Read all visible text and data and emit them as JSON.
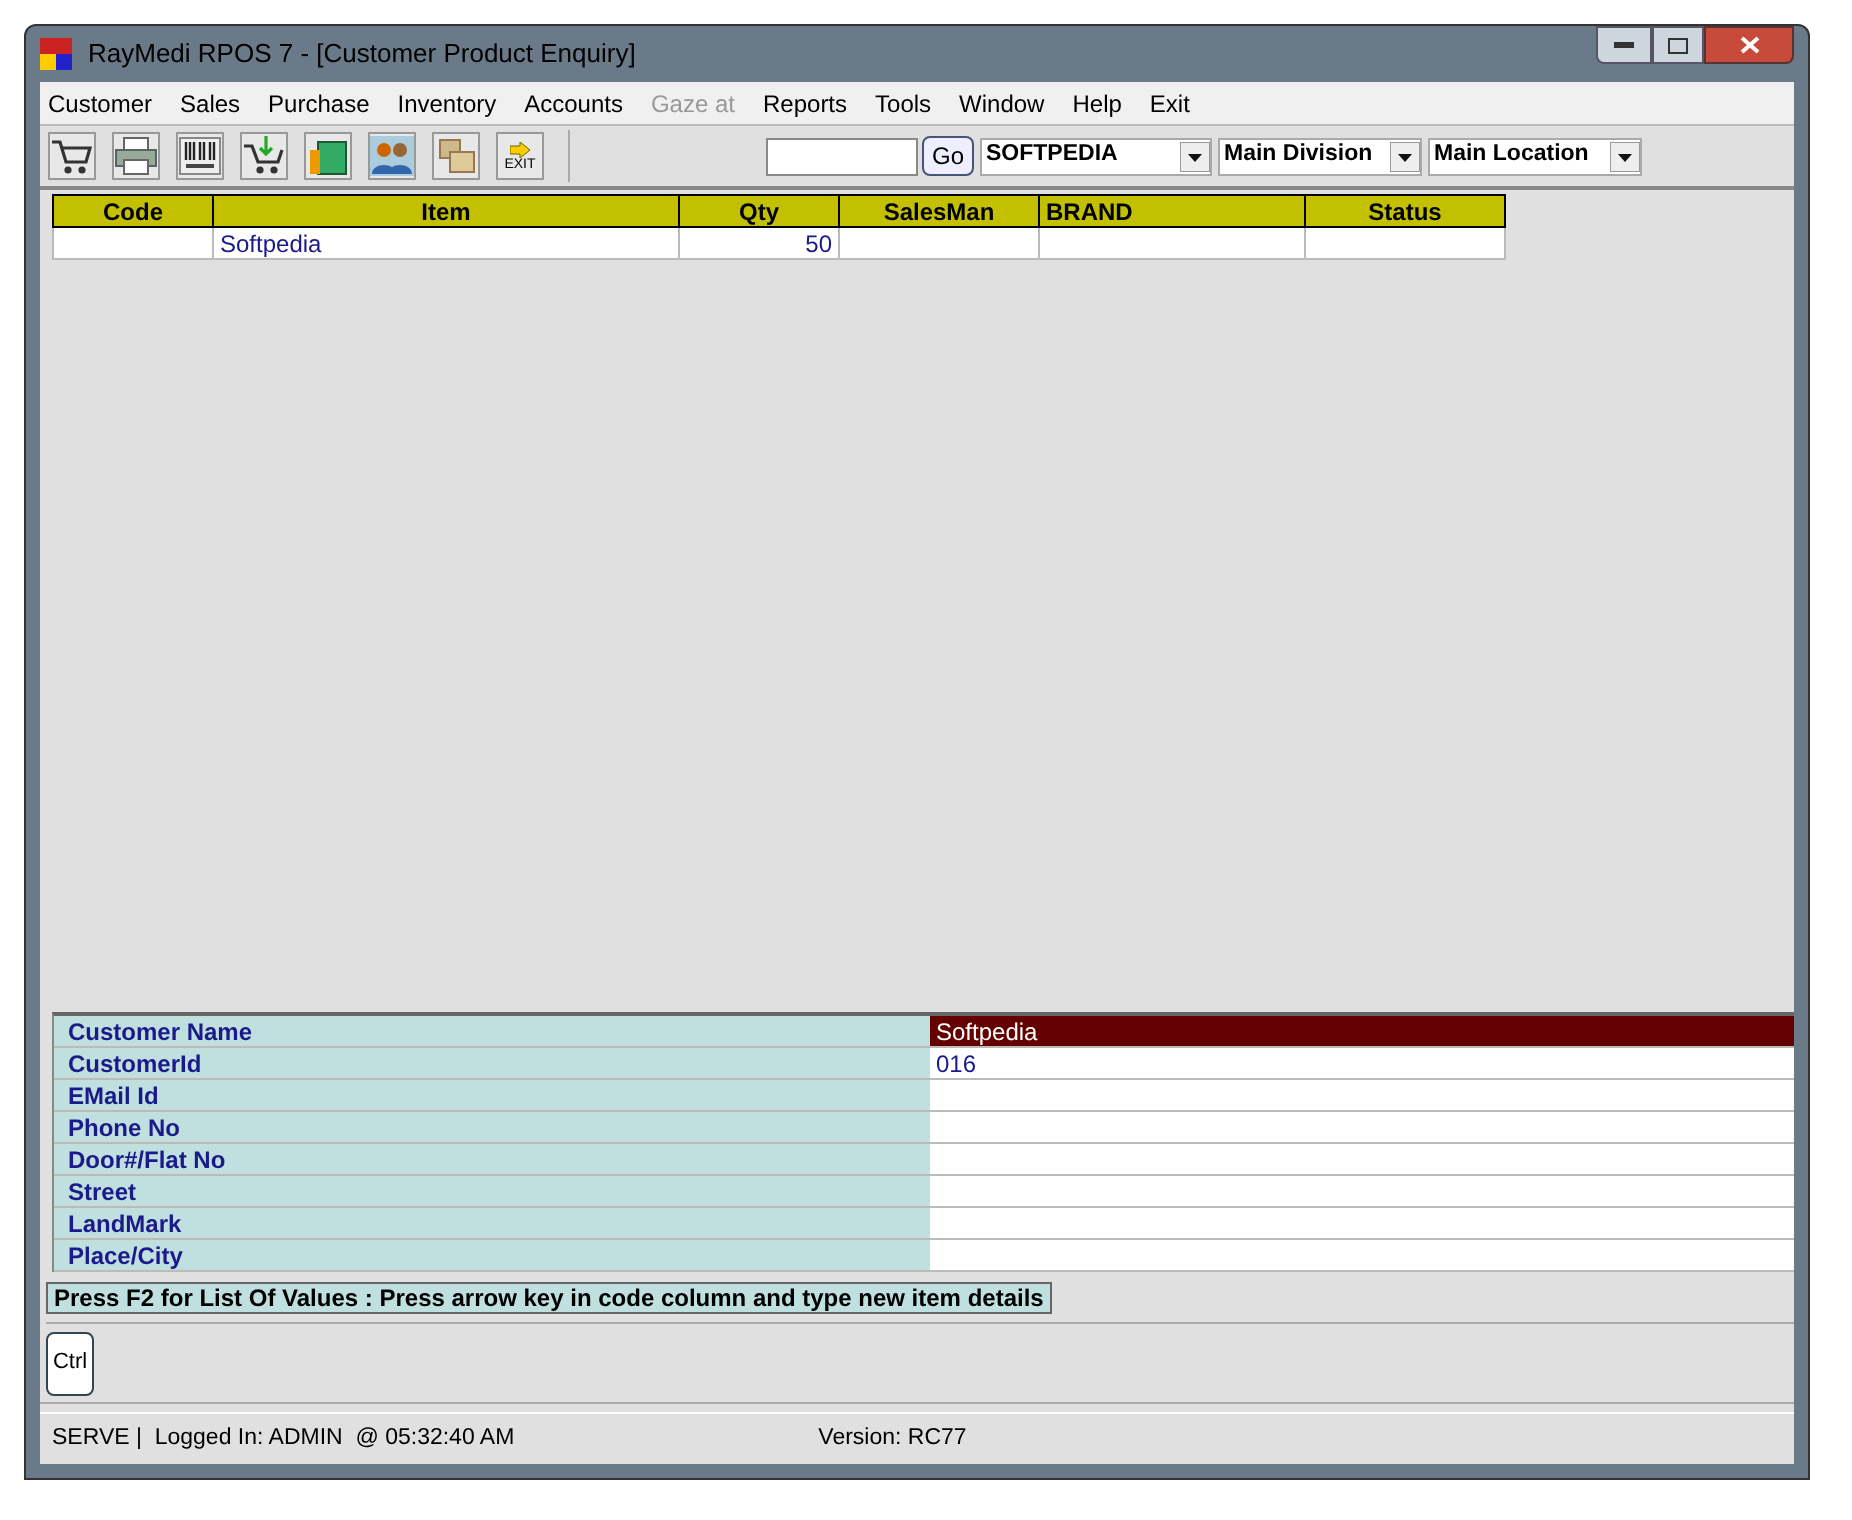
{
  "window": {
    "title": "RayMedi RPOS 7 - [Customer Product Enquiry]"
  },
  "menu": [
    {
      "label": "Customer",
      "disabled": false
    },
    {
      "label": "Sales",
      "disabled": false
    },
    {
      "label": "Purchase",
      "disabled": false
    },
    {
      "label": "Inventory",
      "disabled": false
    },
    {
      "label": "Accounts",
      "disabled": false
    },
    {
      "label": "Gaze at",
      "disabled": true
    },
    {
      "label": "Reports",
      "disabled": false
    },
    {
      "label": "Tools",
      "disabled": false
    },
    {
      "label": "Window",
      "disabled": false
    },
    {
      "label": "Help",
      "disabled": false
    },
    {
      "label": "Exit",
      "disabled": false
    }
  ],
  "toolbar": {
    "exit_label": "EXIT",
    "go_label": "Go",
    "dropdowns": [
      {
        "value": "SOFTPEDIA"
      },
      {
        "value": "Main Division"
      },
      {
        "value": "Main Location"
      }
    ]
  },
  "grid": {
    "columns": [
      {
        "label": "Code"
      },
      {
        "label": "Item"
      },
      {
        "label": "Qty"
      },
      {
        "label": "SalesMan"
      },
      {
        "label": "BRAND"
      },
      {
        "label": "Status"
      }
    ],
    "rows": [
      {
        "cells": [
          "",
          "Softpedia",
          "50",
          "",
          "",
          ""
        ]
      }
    ]
  },
  "customer": [
    {
      "label": "Customer Name",
      "value": "Softpedia",
      "selected": true
    },
    {
      "label": "CustomerId",
      "value": "016",
      "selected": false
    },
    {
      "label": "EMail Id",
      "selected": false
    },
    {
      "label": "Phone No",
      "selected": false
    },
    {
      "label": "Door#/Flat No",
      "selected": false
    },
    {
      "label": "Street",
      "selected": false
    },
    {
      "label": "LandMark",
      "selected": false
    },
    {
      "label": "Place/City",
      "selected": false
    }
  ],
  "hint": "Press F2 for List Of Values : Press arrow key in code column and type new item details",
  "ctrl_button": "Ctrl",
  "status_bar": {
    "left": "SERVE |  Logged In: ADMIN  @ 05:32:40 AM",
    "version": "Version: RC77"
  }
}
